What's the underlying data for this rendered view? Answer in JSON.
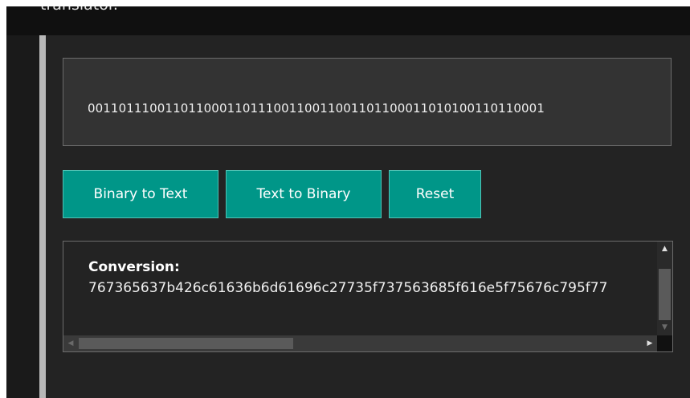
{
  "header": {
    "partial_text": "translator."
  },
  "input": {
    "value": "00110111001101100011011100110011001101100011010100110110001"
  },
  "buttons": {
    "binary_to_text": "Binary to Text",
    "text_to_binary": "Text to Binary",
    "reset": "Reset"
  },
  "output": {
    "label": "Conversion:",
    "value": "767365637b426c61636b6d61696c27735f737563685f616e5f75676c795f77"
  },
  "scrollbar": {
    "up_glyph": "▲",
    "down_glyph": "▼",
    "left_glyph": "◀",
    "right_glyph": "▶"
  },
  "colors": {
    "accent": "#009688",
    "background": "#232323",
    "field": "#333333"
  }
}
